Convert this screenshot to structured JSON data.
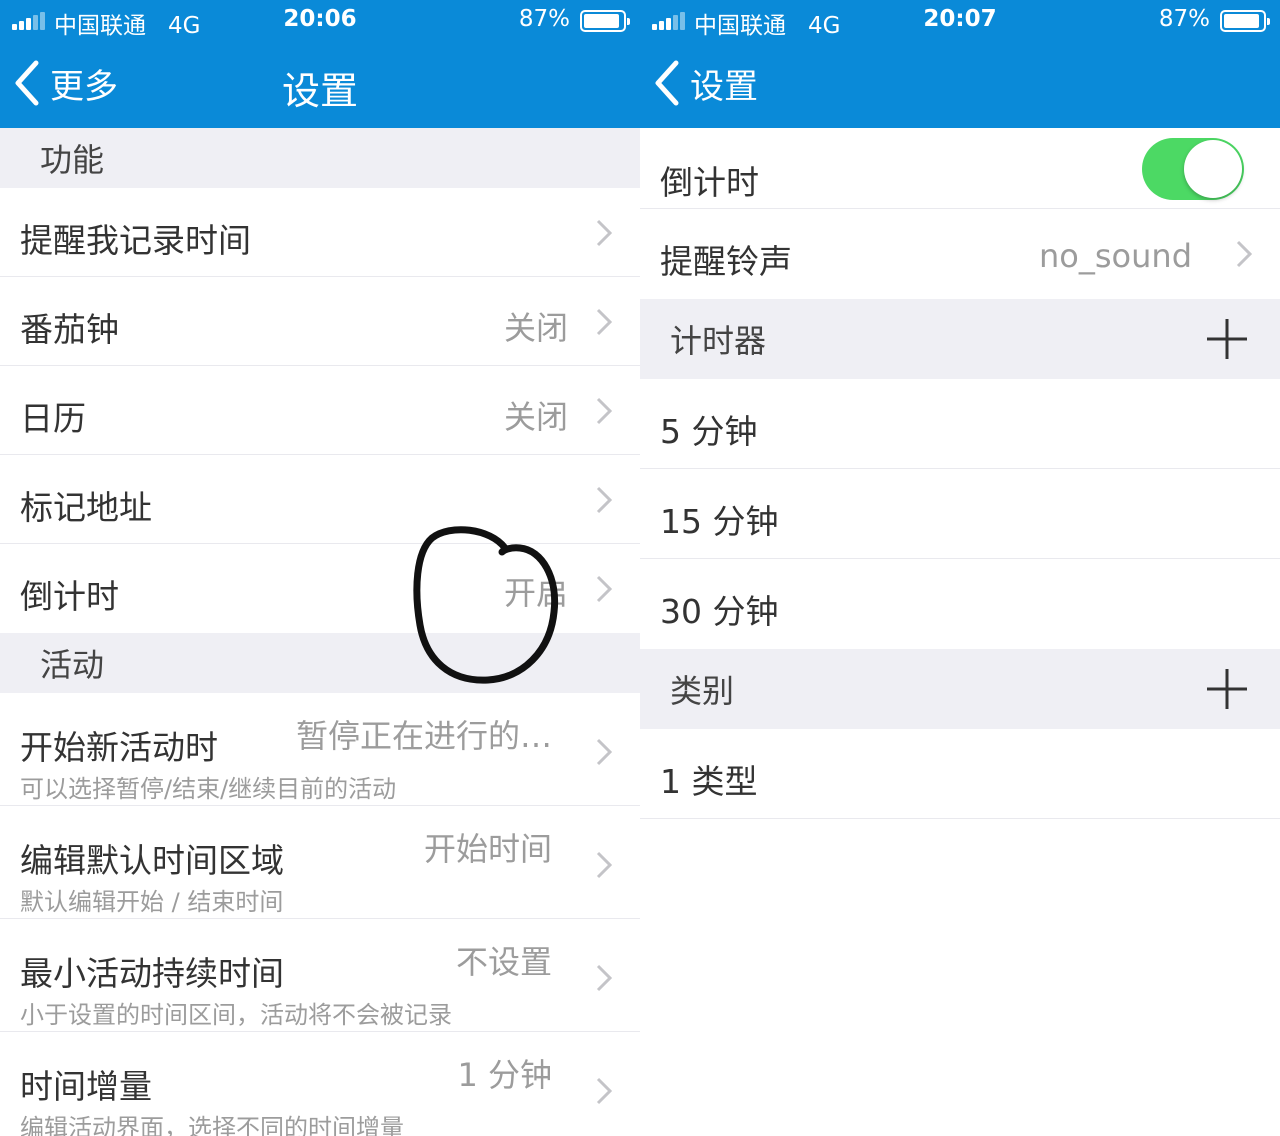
{
  "left": {
    "status": {
      "carrier": "中国联通",
      "network": "4G",
      "time": "20:06",
      "battery": "87%"
    },
    "nav": {
      "back_label": "更多",
      "title": "设置"
    },
    "sections": {
      "function": "功能",
      "activity": "活动"
    },
    "rows": [
      {
        "label": "提醒我记录时间",
        "value": ""
      },
      {
        "label": "番茄钟",
        "value": "关闭"
      },
      {
        "label": "日历",
        "value": "关闭"
      },
      {
        "label": "标记地址",
        "value": ""
      },
      {
        "label": "倒计时",
        "value": "开启"
      }
    ],
    "activity_rows": [
      {
        "label": "开始新活动时",
        "value": "暂停正在进行的…",
        "sub": "可以选择暂停/结束/继续目前的活动"
      },
      {
        "label": "编辑默认时间区域",
        "value": "开始时间",
        "sub": "默认编辑开始 / 结束时间"
      },
      {
        "label": "最小活动持续时间",
        "value": "不设置",
        "sub": "小于设置的时间区间，活动将不会被记录"
      },
      {
        "label": "时间增量",
        "value": "1 分钟",
        "sub": "编辑活动界面，选择不同的时间增量"
      }
    ]
  },
  "right": {
    "status": {
      "carrier": "中国联通",
      "network": "4G",
      "time": "20:07",
      "battery": "87%"
    },
    "nav": {
      "back_label": "设置"
    },
    "countdown": {
      "label": "倒计时",
      "enabled": true
    },
    "ringtone": {
      "label": "提醒铃声",
      "value": "no_sound"
    },
    "timers_section": "计时器",
    "timers": [
      "5 分钟",
      "15 分钟",
      "30 分钟"
    ],
    "categories_section": "类别",
    "categories": [
      "1 类型"
    ]
  },
  "colors": {
    "header": "#0a8ad8",
    "toggle_on": "#4cd964",
    "section_bg": "#efeff4"
  }
}
